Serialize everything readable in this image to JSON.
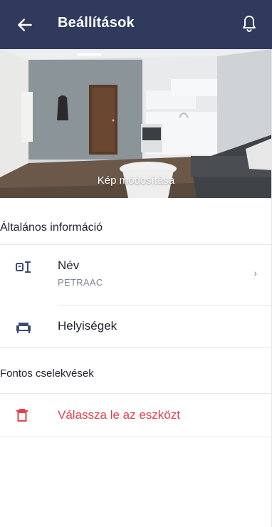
{
  "header": {
    "title": "Beállítások",
    "back_icon": "arrow-left-icon",
    "bell_icon": "bell-icon"
  },
  "hero": {
    "caption": "Kép módosítása"
  },
  "general": {
    "title": "Általános információ",
    "name_row": {
      "label": "Név",
      "value": "PETRAAC",
      "icon": "badge-icon",
      "chevron": "›"
    },
    "rooms_row": {
      "label": "Helyiségek",
      "icon": "sofa-icon"
    }
  },
  "actions": {
    "title": "Fontos cselekvések",
    "remove_row": {
      "label": "Válassza le az eszközt",
      "icon": "trash-icon"
    }
  },
  "colors": {
    "appbar": "#2f3a5c",
    "accent": "#3b4a7a",
    "danger": "#e5404a",
    "secondary_text": "#7c8598"
  }
}
